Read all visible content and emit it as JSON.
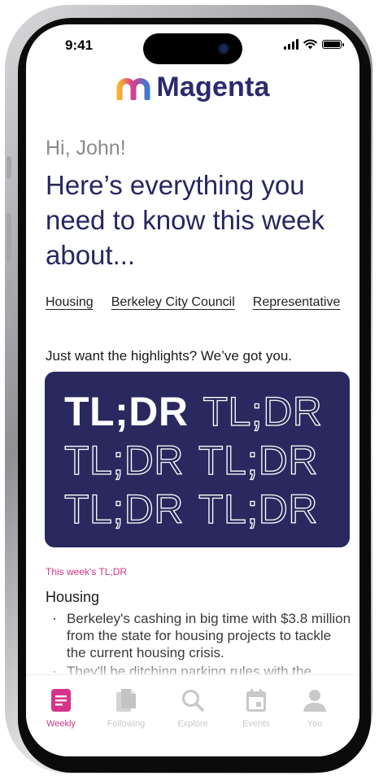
{
  "status_bar": {
    "time": "9:41"
  },
  "app": {
    "name": "Magenta"
  },
  "greeting": "Hi, John!",
  "headline": "Here’s everything you need to know this week about...",
  "topics": [
    "Housing",
    "Berkeley City Council",
    "Representative"
  ],
  "highlights_prompt": "Just want the highlights? We’ve got you.",
  "tldr_card": {
    "word": "TL;DR"
  },
  "section": {
    "label": "This week's TL;DR",
    "title": "Housing",
    "bullets": [
      "Berkeley's cashing in big time with $3.8 million from the state for housing projects to tackle the current housing crisis.",
      "They'll be ditching parking rules with the"
    ]
  },
  "tabbar": {
    "tabs": [
      {
        "label": "Weekly",
        "icon": "document-icon",
        "active": true
      },
      {
        "label": "Following",
        "icon": "pages-icon",
        "active": false
      },
      {
        "label": "Explore",
        "icon": "search-icon",
        "active": false
      },
      {
        "label": "Events",
        "icon": "calendar-icon",
        "active": false
      },
      {
        "label": "You",
        "icon": "person-icon",
        "active": false
      }
    ],
    "active_color": "#D6348A",
    "inactive_color": "#C9C9C9"
  },
  "colors": {
    "brand_navy": "#2C2A6E",
    "accent_magenta": "#D6348A",
    "card_bg": "#29295F"
  }
}
